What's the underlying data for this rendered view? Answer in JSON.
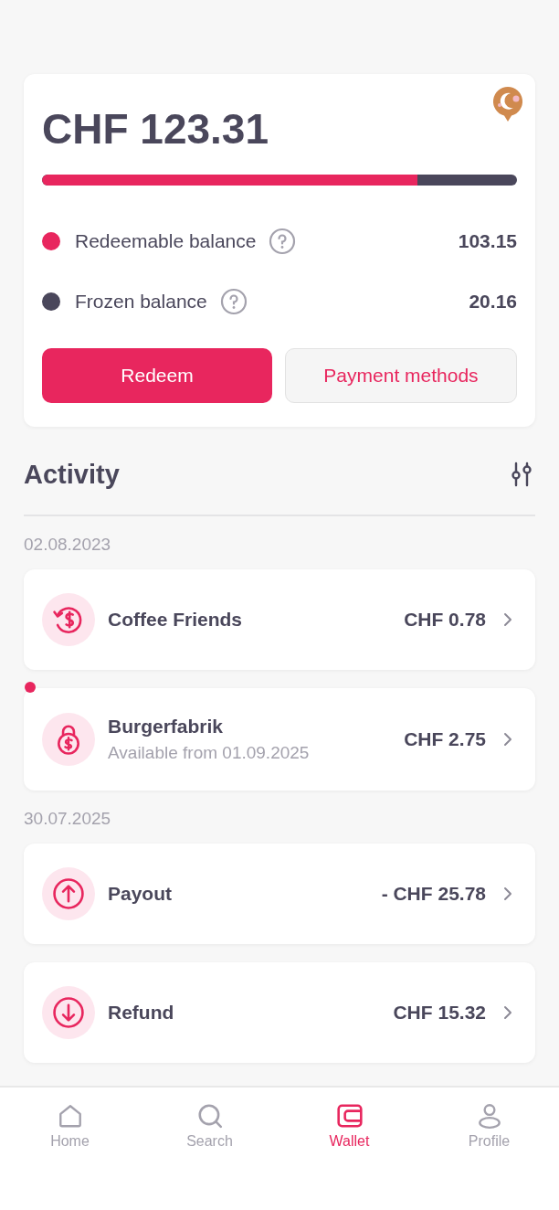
{
  "balance": {
    "total": "CHF 123.31",
    "level": 0.79,
    "rows": [
      {
        "label": "Redeemable balance",
        "value": "103.15",
        "color": "#e8265e"
      },
      {
        "label": "Frozen balance",
        "value": "20.16",
        "color": "#4a475b"
      }
    ],
    "buttons": [
      {
        "label": "Redeem",
        "kind": "primary"
      },
      {
        "label": "Payment methods",
        "kind": "secondary"
      }
    ]
  },
  "activity": {
    "title": "Activity",
    "groups": [
      {
        "date": "02.08.2023",
        "items": [
          {
            "kind": "cashback",
            "title": "Coffee Friends",
            "amount": "CHF 0.78",
            "unread": false
          },
          {
            "kind": "locked",
            "title": "Burgerfabrik",
            "subtitle": "Available from 01.09.2025",
            "amount": "CHF 2.75",
            "unread": true
          }
        ]
      },
      {
        "date": "30.07.2025",
        "items": [
          {
            "kind": "payout",
            "title": "Payout",
            "amount": "- CHF 25.78",
            "unread": false
          },
          {
            "kind": "refund",
            "title": "Refund",
            "amount": "CHF 15.32",
            "unread": false
          }
        ]
      }
    ]
  },
  "nav": [
    {
      "kind": "home",
      "label": "Home",
      "selected": false
    },
    {
      "kind": "search",
      "label": "Search",
      "selected": false
    },
    {
      "kind": "wallet",
      "label": "Wallet",
      "selected": true
    },
    {
      "kind": "profile",
      "label": "Profile",
      "selected": false
    }
  ]
}
